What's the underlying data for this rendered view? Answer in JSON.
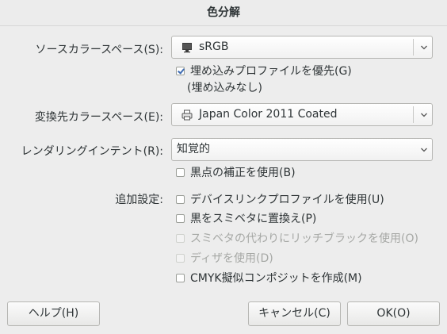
{
  "dialog": {
    "title": "色分解"
  },
  "source": {
    "label": "ソースカラースペース(S):",
    "value": "sRGB",
    "icon": "monitor-icon",
    "prefer_embedded_label": "埋め込みプロファイルを優先(G)",
    "prefer_embedded_checked": true,
    "embedded_status": "(埋め込みなし)"
  },
  "destination": {
    "label": "変換先カラースペース(E):",
    "value": "Japan Color 2011 Coated",
    "icon": "printer-icon"
  },
  "intent": {
    "label": "レンダリングインテント(R):",
    "value": "知覚的",
    "black_point_label": "黒点の補正を使用(B)",
    "black_point_checked": false
  },
  "additional": {
    "label": "追加設定:",
    "options": [
      {
        "label": "デバイスリンクプロファイルを使用(U)",
        "checked": false,
        "enabled": true
      },
      {
        "label": "黒をスミベタに置換え(P)",
        "checked": false,
        "enabled": true
      },
      {
        "label": "スミベタの代わりにリッチブラックを使用(O)",
        "checked": false,
        "enabled": false
      },
      {
        "label": "ディザを使用(D)",
        "checked": false,
        "enabled": false
      },
      {
        "label": "CMYK擬似コンポジットを作成(M)",
        "checked": false,
        "enabled": true
      }
    ]
  },
  "buttons": {
    "help": "ヘルプ(H)",
    "cancel": "キャンセル(C)",
    "ok": "OK(O)"
  }
}
